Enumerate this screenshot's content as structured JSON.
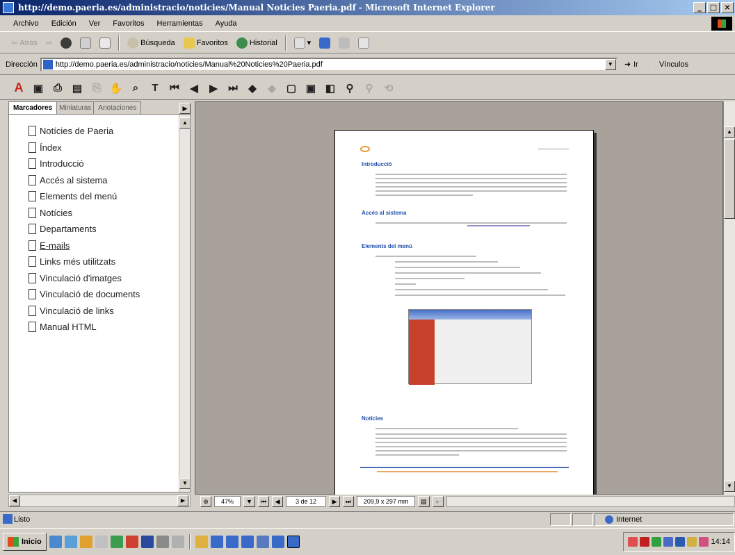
{
  "window": {
    "title": "http://demo.paeria.es/administracio/noticies/Manual Noticies Paeria.pdf - Microsoft Internet Explorer",
    "minimize": "_",
    "maximize": "□",
    "close": "×"
  },
  "menu": [
    "Archivo",
    "Edición",
    "Ver",
    "Favoritos",
    "Herramientas",
    "Ayuda"
  ],
  "toolbar": {
    "back": "Atrás",
    "search": "Búsqueda",
    "favorites": "Favoritos",
    "history": "Historial"
  },
  "address": {
    "label": "Dirección",
    "url": "http://demo.paeria.es/administracio/noticies/Manual%20Noticies%20Paeria.pdf",
    "go": "Ir",
    "links": "Vínculos"
  },
  "sidebar": {
    "tabs": [
      "Marcadores",
      "Miniaturas",
      "Anotaciones"
    ],
    "bookmarks": [
      "Notícies de Paeria",
      "Índex",
      "Introducció",
      "Accés al sistema",
      "Elements del menú",
      "Notícies",
      "Departaments",
      "E-mails",
      "Links més utilitzats",
      "Vinculació d'imatges",
      "Vinculació de documents",
      "Vinculació de links",
      "Manual HTML"
    ]
  },
  "pdf_page": {
    "h1": "Introducció",
    "h2": "Accés al sistema",
    "h3": "Elements del menú",
    "h4": "Notícies"
  },
  "navbar": {
    "zoom": "47%",
    "page": "3 de 12",
    "size": "209,9 x 297 mm"
  },
  "status": {
    "text": "Listo",
    "zone": "Internet"
  },
  "taskbar": {
    "start": "Inicio",
    "clock": "14:14"
  },
  "colors": {
    "titlebar_start": "#0a246a",
    "titlebar_end": "#a6caf0",
    "heading_blue": "#2350a8"
  }
}
